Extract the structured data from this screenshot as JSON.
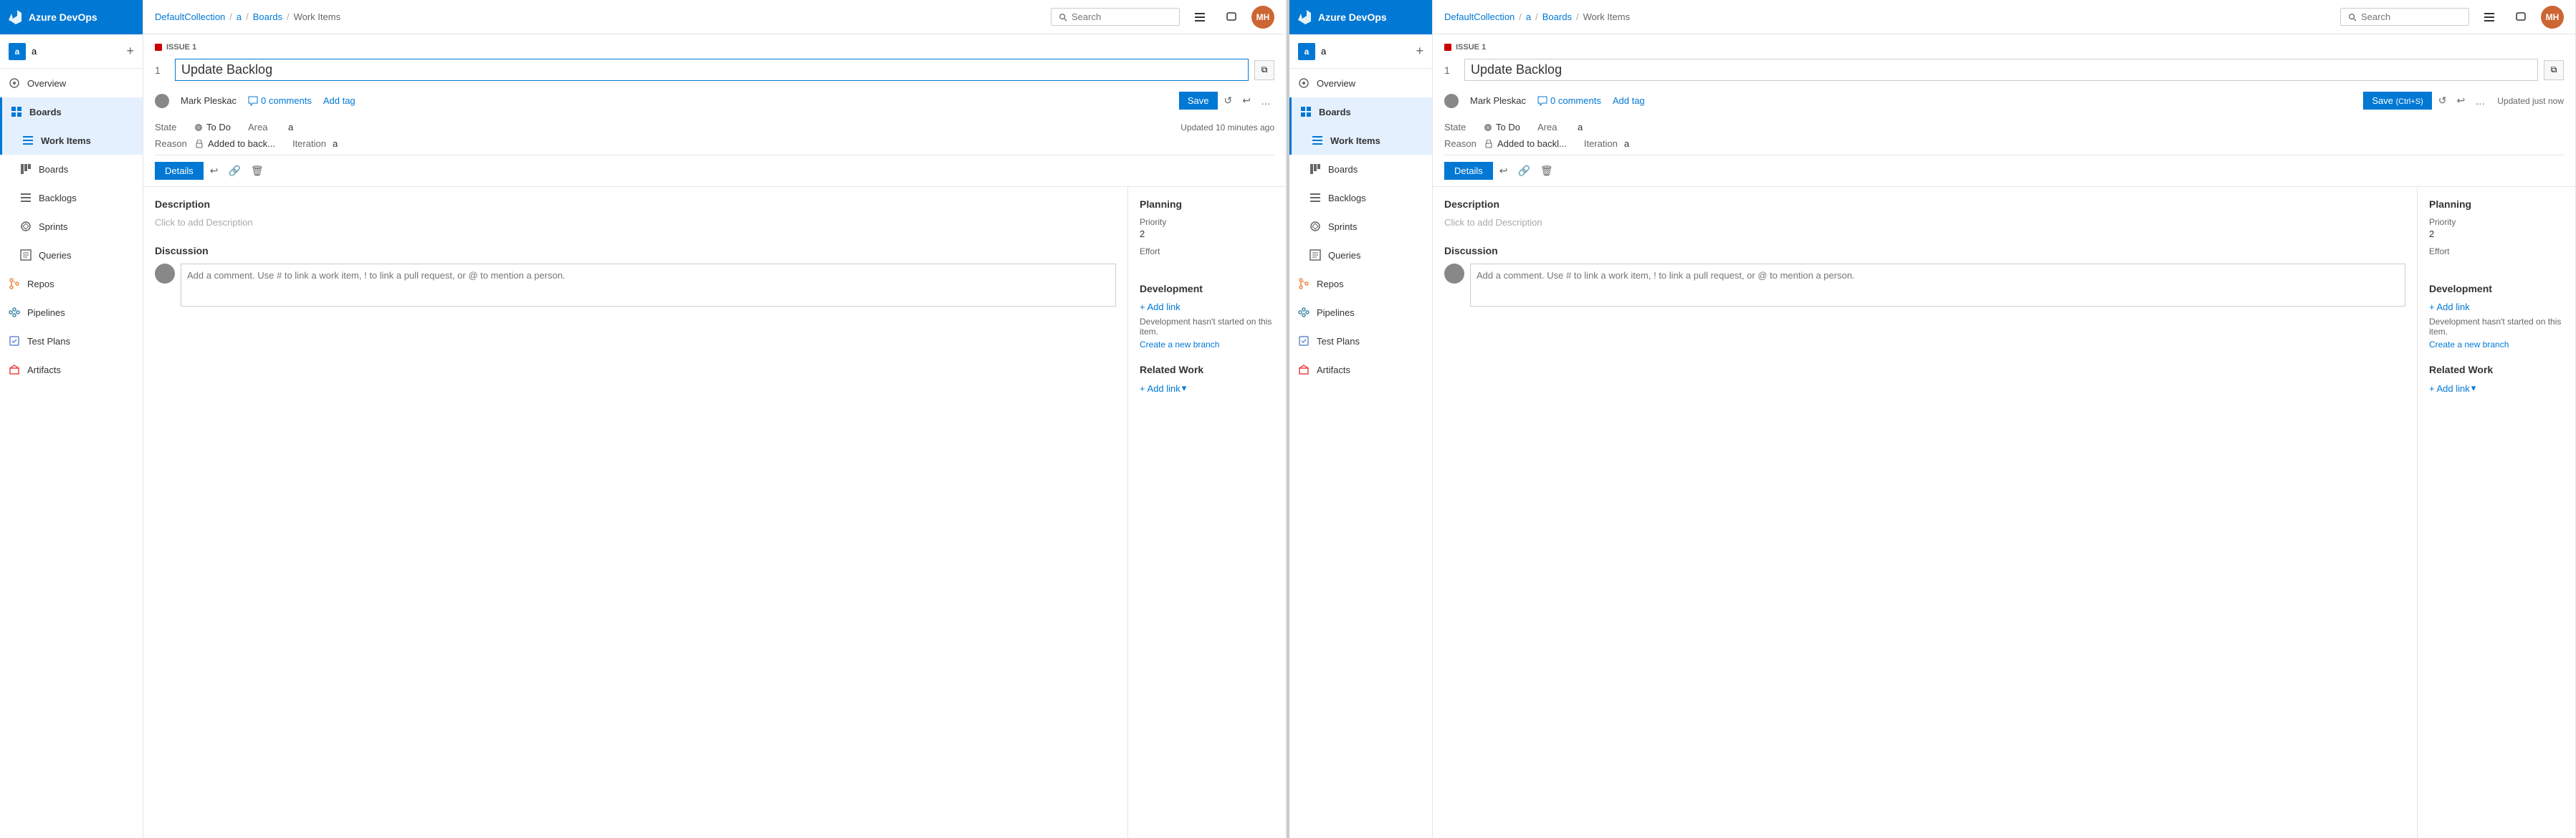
{
  "panels": [
    {
      "id": "panel1",
      "header": {
        "azure_logo": "Azure DevOps",
        "breadcrumb": [
          "DefaultCollection",
          "a",
          "Boards",
          "Work Items"
        ],
        "search_placeholder": "Search",
        "user_initials": "MH"
      },
      "sidebar": {
        "org_initial": "a",
        "org_name": "a",
        "nav_items": [
          {
            "id": "overview",
            "label": "Overview",
            "icon": "home"
          },
          {
            "id": "boards",
            "label": "Boards",
            "icon": "boards",
            "active": true
          },
          {
            "id": "work-items",
            "label": "Work Items",
            "icon": "list",
            "active": true
          },
          {
            "id": "boards2",
            "label": "Boards",
            "icon": "grid"
          },
          {
            "id": "backlogs",
            "label": "Backlogs",
            "icon": "backlog"
          },
          {
            "id": "sprints",
            "label": "Sprints",
            "icon": "sprint"
          },
          {
            "id": "queries",
            "label": "Queries",
            "icon": "query"
          },
          {
            "id": "repos",
            "label": "Repos",
            "icon": "repos"
          },
          {
            "id": "pipelines",
            "label": "Pipelines",
            "icon": "pipelines"
          },
          {
            "id": "test-plans",
            "label": "Test Plans",
            "icon": "test"
          },
          {
            "id": "artifacts",
            "label": "Artifacts",
            "icon": "artifacts"
          }
        ]
      },
      "work_item": {
        "issue_label": "ISSUE 1",
        "issue_number": "1",
        "title": "Update Backlog",
        "author": "Mark Pleskac",
        "comments_count": "0 comments",
        "add_tag": "Add tag",
        "save_btn": "Save",
        "state_label": "State",
        "state_value": "To Do",
        "area_label": "Area",
        "area_value": "a",
        "reason_label": "Reason",
        "reason_value": "Added to back...",
        "iteration_label": "Iteration",
        "iteration_value": "a",
        "timestamp": "Updated 10 minutes ago",
        "details_tab": "Details",
        "description_title": "Description",
        "description_placeholder": "Click to add Description",
        "discussion_title": "Discussion",
        "comment_placeholder": "Add a comment. Use # to link a work item, ! to link a pull request, or @ to mention a person.",
        "planning_title": "Planning",
        "priority_label": "Priority",
        "priority_value": "2",
        "effort_label": "Effort",
        "effort_value": "",
        "development_title": "Development",
        "add_link_label": "+ Add link",
        "dev_note": "Development hasn't started on this item.",
        "create_branch": "Create a new branch",
        "related_work_title": "Related Work",
        "related_add_link": "+ Add link"
      }
    },
    {
      "id": "panel2",
      "header": {
        "azure_logo": "Azure DevOps",
        "breadcrumb": [
          "DefaultCollection",
          "a",
          "Boards",
          "Work Items"
        ],
        "search_placeholder": "Search",
        "user_initials": "MH"
      },
      "sidebar": {
        "org_initial": "a",
        "org_name": "a",
        "nav_items": [
          {
            "id": "overview",
            "label": "Overview",
            "icon": "home"
          },
          {
            "id": "boards",
            "label": "Boards",
            "icon": "boards",
            "active": true
          },
          {
            "id": "work-items",
            "label": "Work Items",
            "icon": "list",
            "active": true
          },
          {
            "id": "boards2",
            "label": "Boards",
            "icon": "grid"
          },
          {
            "id": "backlogs",
            "label": "Backlogs",
            "icon": "backlog"
          },
          {
            "id": "sprints",
            "label": "Sprints",
            "icon": "sprint"
          },
          {
            "id": "queries",
            "label": "Queries",
            "icon": "query"
          },
          {
            "id": "repos",
            "label": "Repos",
            "icon": "repos"
          },
          {
            "id": "pipelines",
            "label": "Pipelines",
            "icon": "pipelines"
          },
          {
            "id": "test-plans",
            "label": "Test Plans",
            "icon": "test"
          },
          {
            "id": "artifacts",
            "label": "Artifacts",
            "icon": "artifacts"
          }
        ]
      },
      "work_item": {
        "issue_label": "ISSUE 1",
        "issue_number": "1",
        "title": "Update Backlog",
        "author": "Mark Pleskac",
        "comments_count": "0 comments",
        "add_tag": "Add tag",
        "save_btn": "Save",
        "save_shortcut": "(Ctrl+S)",
        "state_label": "State",
        "state_value": "To Do",
        "area_label": "Area",
        "area_value": "a",
        "reason_label": "Reason",
        "reason_value": "Added to backl...",
        "iteration_label": "Iteration",
        "iteration_value": "a",
        "timestamp": "Updated just now",
        "details_tab": "Details",
        "description_title": "Description",
        "description_placeholder": "Click to add Description",
        "discussion_title": "Discussion",
        "comment_placeholder": "Add a comment. Use # to link a work item, ! to link a pull request, or @ to mention a person.",
        "planning_title": "Planning",
        "priority_label": "Priority",
        "priority_value": "2",
        "effort_label": "Effort",
        "effort_value": "",
        "development_title": "Development",
        "add_link_label": "+ Add link",
        "dev_note": "Development hasn't started on this item.",
        "create_branch": "Create a new branch",
        "related_work_title": "Related Work",
        "related_add_link": "+ Add link"
      }
    }
  ],
  "icons": {
    "home": "⊙",
    "boards": "▦",
    "list": "☰",
    "grid": "▦",
    "backlog": "≡",
    "sprint": "◎",
    "query": "⊞",
    "repos": "⊡",
    "pipelines": "⊟",
    "test": "⊠",
    "artifacts": "⊞",
    "search": "🔍",
    "comment": "💬",
    "lock": "🔒",
    "link": "🔗",
    "trash": "🗑",
    "history": "↩",
    "undo": "↺",
    "redo": "↻",
    "more": "…",
    "copy": "⧉",
    "plus": "+",
    "chevron": "▾"
  }
}
